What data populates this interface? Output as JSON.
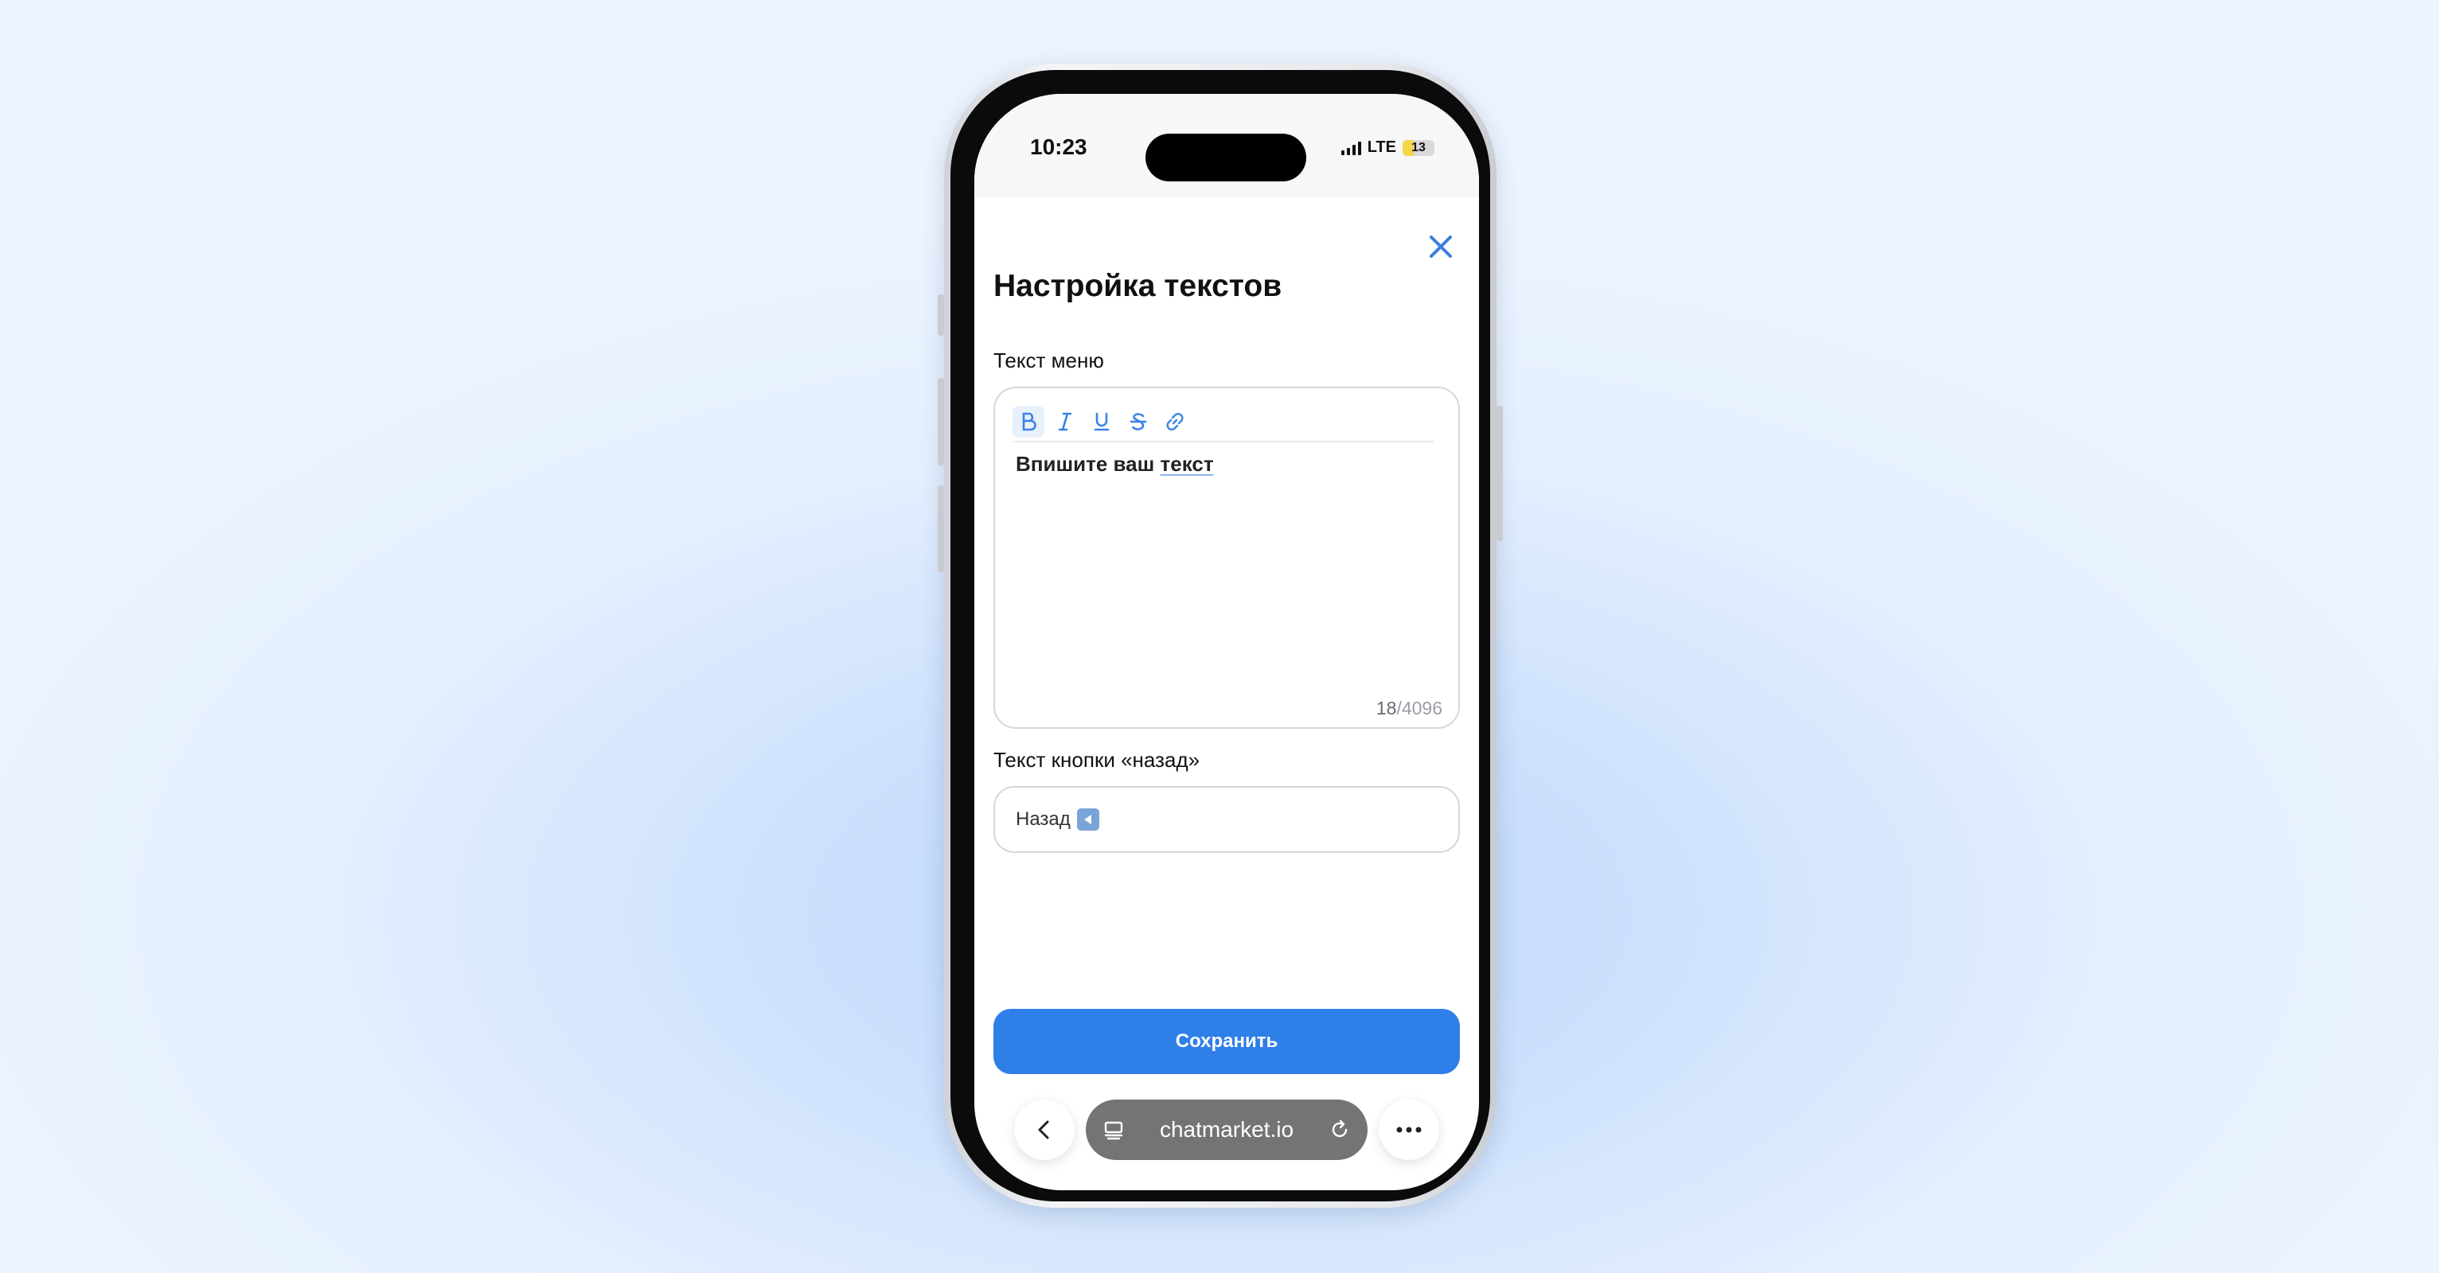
{
  "status_bar": {
    "time": "10:23",
    "network": "LTE",
    "battery_level": "13"
  },
  "modal": {
    "title": "Настройка текстов",
    "close_icon": "close-icon"
  },
  "menu_text": {
    "label": "Текст меню",
    "toolbar": [
      "bold",
      "italic",
      "underline",
      "strikethrough",
      "link"
    ],
    "value_prefix": "Впишите ваш ",
    "value_misspelled": "текст",
    "char_count": "18",
    "char_limit": "/4096"
  },
  "back_button_text": {
    "label": "Текст кнопки «назад»",
    "value": "Назад"
  },
  "save_button": {
    "label": "Сохранить"
  },
  "browser": {
    "url": "chatmarket.io"
  },
  "colors": {
    "accent": "#2f7fe8",
    "url_bar": "#747477"
  }
}
